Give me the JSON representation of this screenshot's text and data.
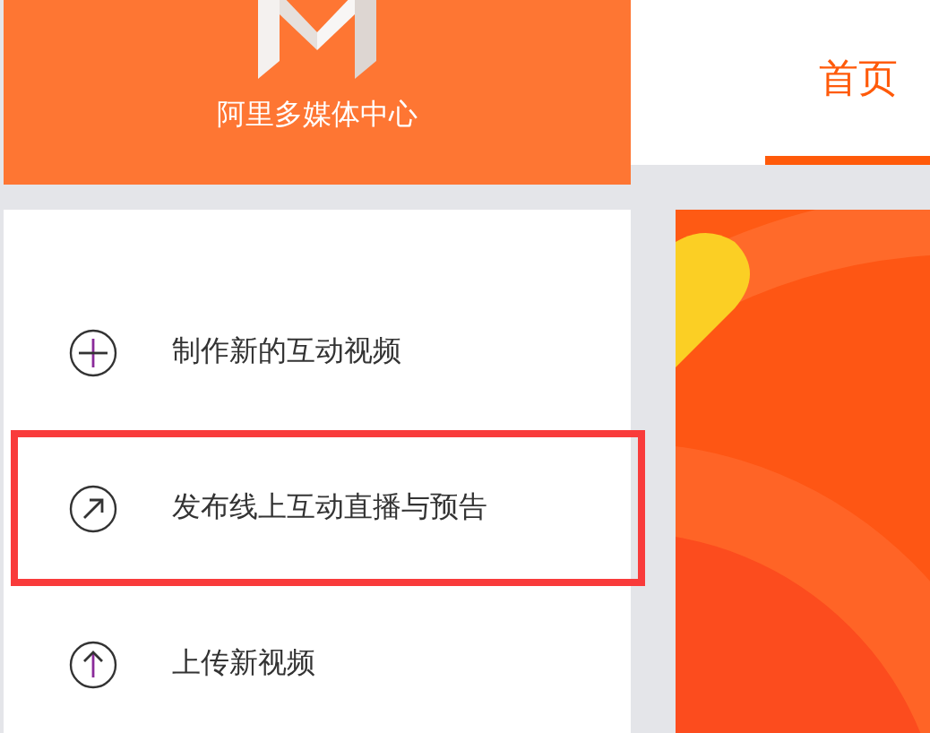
{
  "brand": {
    "name": "阿里多媒体中心"
  },
  "tabs": [
    {
      "label": "首页",
      "selected": true
    }
  ],
  "menu": [
    {
      "label": "制作新的互动视频",
      "kind": "plus",
      "selected": false
    },
    {
      "label": "发布线上互动直播与预告",
      "kind": "share",
      "selected": true
    },
    {
      "label": "上传新视频",
      "kind": "upload",
      "selected": false
    }
  ]
}
